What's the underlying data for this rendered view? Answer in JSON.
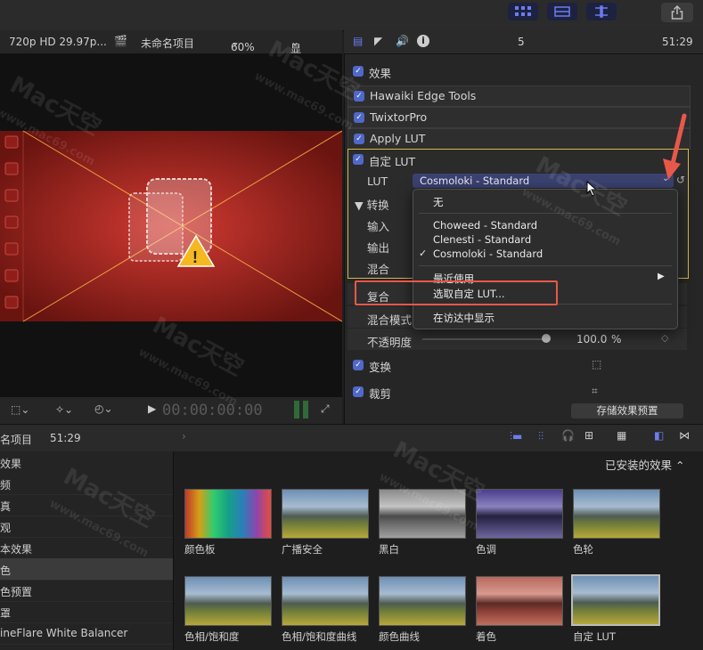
{
  "viewer": {
    "format": "720p HD 29.97p...",
    "project": "未命名项目",
    "zoom": "60%",
    "display": "显示",
    "timecode": "00:00:00:00"
  },
  "inspector": {
    "number": "5",
    "duration": "51:29",
    "effects_heading": "效果",
    "effects": [
      "Hawaiki Edge Tools",
      "TwixtorPro",
      "Apply LUT",
      "自定 LUT"
    ],
    "lut_label": "LUT",
    "lut_value": "Cosmoloki - Standard",
    "transform_label": "转换",
    "input_label": "输入",
    "output_label": "输出",
    "mix_label": "混合",
    "composite_label": "复合",
    "blend_mode_label": "混合模式",
    "opacity_label": "不透明度",
    "opacity_value": "100.0",
    "opacity_unit": "%",
    "transform_section": "变换",
    "crop_section": "裁剪",
    "save_preset": "存储效果预置"
  },
  "lut_menu": {
    "none": "无",
    "items": [
      "Choweed - Standard",
      "Clenesti - Standard",
      "Cosmoloki - Standard"
    ],
    "checked_index": 2,
    "recent": "最近使用",
    "choose_custom": "选取自定 LUT...",
    "show_in_finder": "在访达中显示"
  },
  "timeline": {
    "project": "名项目",
    "duration": "51:29"
  },
  "sidebar": {
    "title": "效果",
    "items": [
      "频",
      "真",
      "观",
      "本效果",
      "色",
      "色预置",
      "罩",
      "ineFlare White Balancer"
    ],
    "selected_index": 4
  },
  "browser": {
    "installed": "已安装的效果",
    "thumbs": [
      "颜色板",
      "广播安全",
      "黑白",
      "色调",
      "色轮",
      "色相/饱和度",
      "色相/饱和度曲线",
      "颜色曲线",
      "着色",
      "自定 LUT"
    ]
  },
  "watermark": {
    "brand": "Mac天空",
    "url": "www.mac69.com"
  },
  "colors": {
    "accent": "#4f68c9",
    "highlight_box": "#e8584a",
    "effect_border": "#d8b84a"
  }
}
